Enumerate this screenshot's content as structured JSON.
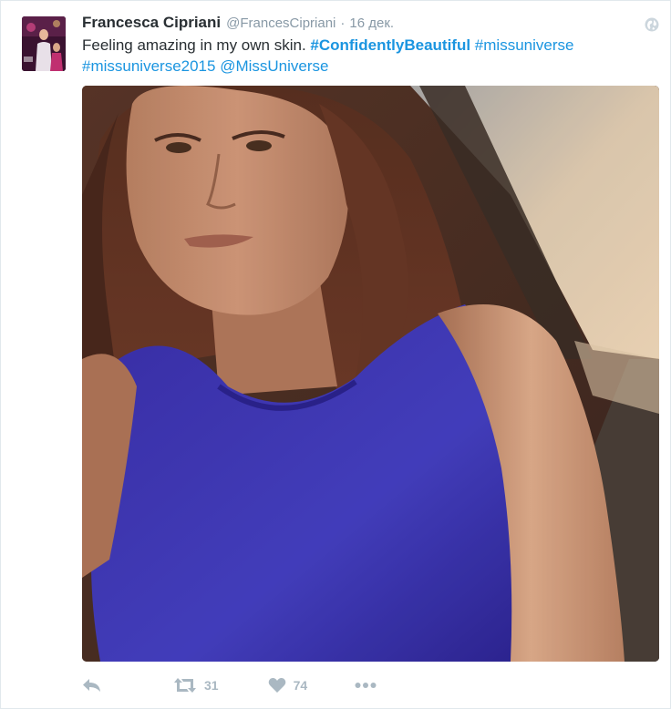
{
  "tweet": {
    "author": {
      "fullname": "Francesca Cipriani",
      "screen_name": "@FrancesCipriani"
    },
    "separator": "·",
    "time": "16 дек.",
    "text_plain": "Feeling amazing in my own skin. ",
    "hashtag_1": "#ConfidentlyBeautiful",
    "hashtag_2": "#missuniverse",
    "hashtag_3": "#missuniverse2015",
    "mention": "@MissUniverse",
    "actions": {
      "retweet_count": "31",
      "like_count": "74"
    }
  },
  "icons": {
    "globe": "globe-icon",
    "reply": "reply-icon",
    "retweet": "retweet-icon",
    "like": "heart-icon",
    "more": "more-icon"
  },
  "colors": {
    "link": "#1b95e0",
    "text": "#292f33",
    "muted": "#8899a6",
    "action": "#aab8c2",
    "border": "#e1e8ed"
  }
}
